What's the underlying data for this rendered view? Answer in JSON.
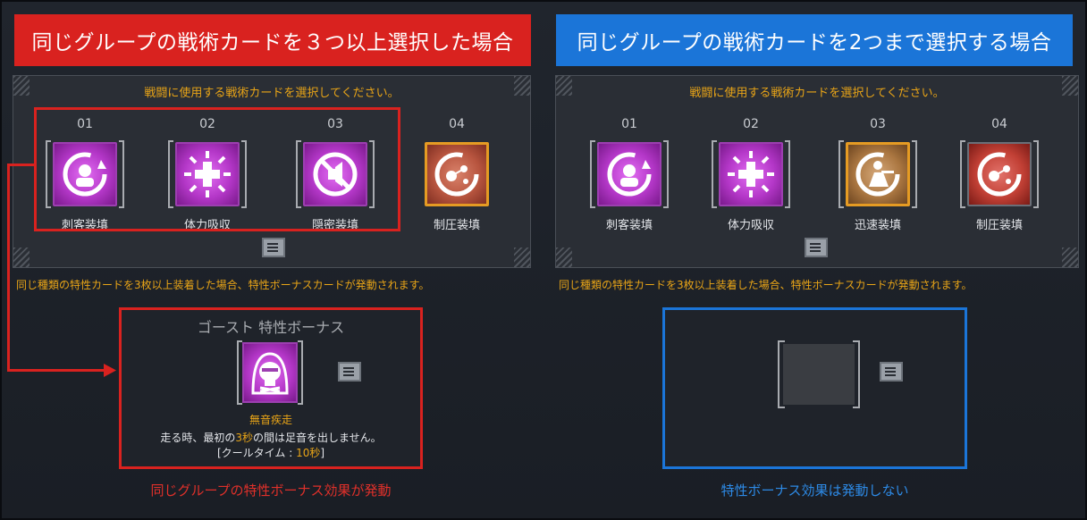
{
  "left": {
    "header": "同じグループの戦術カードを３つ以上選択した場合",
    "panel_title": "戦闘に使用する戦術カードを選択してください。",
    "cards": [
      {
        "num": "01",
        "label": "刺客装填",
        "icon": "assassin-reload-icon",
        "style": "purple"
      },
      {
        "num": "02",
        "label": "体力吸収",
        "icon": "health-absorb-icon",
        "style": "purple"
      },
      {
        "num": "03",
        "label": "隠密装填",
        "icon": "stealth-reload-icon",
        "style": "purple"
      },
      {
        "num": "04",
        "label": "制圧装填",
        "icon": "suppress-reload-icon",
        "style": "orange"
      }
    ],
    "info": "同じ種類の特性カードを3枚以上装着した場合、特性ボーナスカードが発動されます。",
    "bonus": {
      "title": "ゴースト 特性ボーナス",
      "icon": "ghost-skull-icon",
      "name": "無音疾走",
      "desc_pre": "走る時、最初の",
      "desc_hl": "3秒",
      "desc_post": "の間は足音を出しません。",
      "cooldown_pre": "[クールタイム : ",
      "cooldown_hl": "10秒",
      "cooldown_post": "]"
    },
    "caption": "同じグループの特性ボーナス効果が発動"
  },
  "right": {
    "header": "同じグループの戦術カードを2つまで選択する場合",
    "panel_title": "戦闘に使用する戦術カードを選択してください。",
    "cards": [
      {
        "num": "01",
        "label": "刺客装填",
        "icon": "assassin-reload-icon",
        "style": "purple"
      },
      {
        "num": "02",
        "label": "体力吸収",
        "icon": "health-absorb-icon",
        "style": "purple"
      },
      {
        "num": "03",
        "label": "迅速装填",
        "icon": "rapid-reload-icon",
        "style": "gold"
      },
      {
        "num": "04",
        "label": "制圧装填",
        "icon": "suppress-reload-icon",
        "style": "red"
      }
    ],
    "info": "同じ種類の特性カードを3枚以上装着した場合、特性ボーナスカードが発動されます。",
    "caption": "特性ボーナス効果は発動しない"
  },
  "colors": {
    "red_accent": "#d9221f",
    "blue_accent": "#1b75d8",
    "orange_text": "#e8a417"
  }
}
